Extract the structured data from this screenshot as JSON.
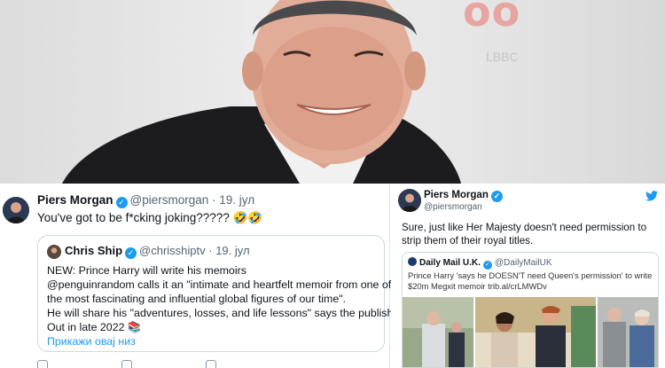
{
  "photo": {
    "backdrop_logo": "oo",
    "backdrop_sub": "LBBC"
  },
  "left_tweet": {
    "name": "Piers Morgan",
    "handle": "@piersmorgan",
    "date": "· 19. јул",
    "text": "You've got to be f*cking joking????? 🤣🤣",
    "quote": {
      "name": "Chris Ship",
      "handle": "@chrisshiptv",
      "date": "· 19. јул",
      "lines": [
        "NEW: Prince Harry will write his memoirs",
        "@penguinrandom calls it an \"intimate and heartfelt memoir from one of",
        "the most fascinating and influential global figures of our time\".",
        "He will share his \"adventures, losses, and life lessons\" says the publisher.",
        "Out in late 2022 📚"
      ],
      "show_thread": "Прикажи овај низ"
    }
  },
  "right_tweet": {
    "name": "Piers Morgan",
    "handle": "@piersmorgan",
    "text": "Sure, just like Her Majesty doesn't need permission to strip them of their royal titles.",
    "card": {
      "source_name": "Daily Mail U.K.",
      "source_handle": "@DailyMailUK",
      "text": "Prince Harry 'says he DOESN'T need Queen's permission' to write $20m Megxit memoir trib.al/crLMWDv"
    }
  },
  "colors": {
    "accent": "#1d9bf0",
    "text": "#0f1419",
    "muted": "#536471",
    "border": "#cfd9de"
  }
}
